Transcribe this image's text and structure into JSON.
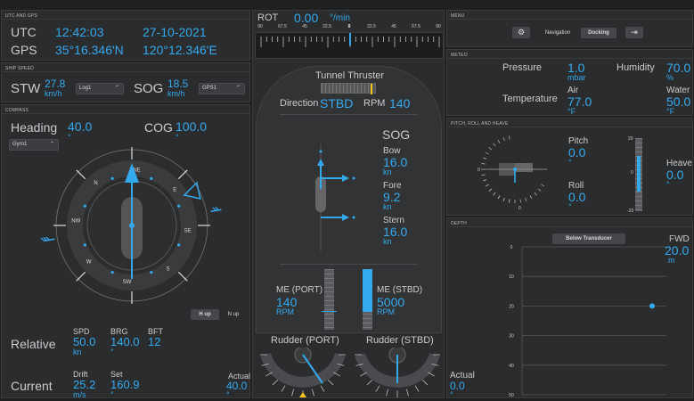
{
  "utc_gps": {
    "header": "UTC AND GPS",
    "utc_label": "UTC",
    "utc_time": "12:42:03",
    "utc_date": "27-10-2021",
    "gps_label": "GPS",
    "gps_lat": "35°16.346'N",
    "gps_lon": "120°12.346'E"
  },
  "ship_speed": {
    "header": "SHIP SPEED",
    "stw_label": "STW",
    "stw_value": "27.8",
    "stw_unit": "km/h",
    "stw_select": "Log1",
    "sog_label": "SOG",
    "sog_value": "18.5",
    "sog_unit": "km/h",
    "sog_select": "GPS1"
  },
  "compass": {
    "header": "COMPASS",
    "heading_label": "Heading",
    "heading_value": "40.0",
    "heading_unit": "°",
    "cog_label": "COG",
    "cog_value": "100.0",
    "cog_unit": "°",
    "gyro_select": "Gyro1",
    "heading_deg": 40,
    "cog_deg": 100,
    "wind_deg": 300,
    "current_deg": 120,
    "directions": [
      "NE",
      "N",
      "E",
      "NW",
      "SE",
      "W",
      "S",
      "SW"
    ],
    "hup_label": "H up",
    "nup_label": "N up",
    "relative_label": "Relative",
    "spd_label": "SPD",
    "spd_value": "50.0",
    "spd_unit": "kn",
    "brg_label": "BRG",
    "brg_value": "140.0",
    "brg_unit": "°",
    "bft_label": "BFT",
    "bft_value": "12",
    "current_label": "Current",
    "drift_label": "Drift",
    "drift_value": "25.2",
    "drift_unit": "m/s",
    "set_label": "Set",
    "set_value": "160.9",
    "set_unit": "°",
    "actual_label": "Actual",
    "actual_value": "40.0",
    "actual_unit": "°"
  },
  "rot": {
    "label": "ROT",
    "value": "0.00",
    "unit": "°/min",
    "ticks": [
      "90",
      "67.5",
      "45",
      "22.5",
      "0",
      "22.5",
      "45",
      "67.5",
      "90"
    ]
  },
  "thruster": {
    "title": "Tunnel Thruster",
    "direction_label": "Direction",
    "direction_value": "STBD",
    "rpm_label": "RPM",
    "rpm_value": "140"
  },
  "sog_panel": {
    "title": "SOG",
    "bow_label": "Bow",
    "bow_value": "16.0",
    "bow_unit": "kn",
    "fore_label": "Fore",
    "fore_value": "9.2",
    "fore_unit": "kn",
    "stern_label": "Stern",
    "stern_value": "16.0",
    "stern_unit": "kn"
  },
  "engines": {
    "port_label": "ME (PORT)",
    "port_value": "140",
    "port_unit": "RPM",
    "port_level": 0.0,
    "stbd_label": "ME (STBD)",
    "stbd_value": "5000",
    "stbd_unit": "RPM",
    "stbd_level": 1.0
  },
  "rudder": {
    "port_label": "Rudder (PORT)",
    "stbd_label": "Rudder (STBD)"
  },
  "menu": {
    "header": "MENU",
    "gear_icon": "gear-icon",
    "navigation_label": "Navigation",
    "docking_label": "Docking",
    "exit_icon": "exit-icon"
  },
  "meteo": {
    "header": "METEO",
    "pressure_label": "Pressure",
    "pressure_value": "1.0",
    "pressure_unit": "mbar",
    "humidity_label": "Humidity",
    "humidity_value": "70.0",
    "humidity_unit": "%",
    "temperature_label": "Temperature",
    "air_label": "Air",
    "air_value": "77.0",
    "air_unit": "°F",
    "water_label": "Water",
    "water_value": "50.0",
    "water_unit": "°F"
  },
  "prh": {
    "header": "PITCH, ROLL AND HEAVE",
    "pitch_label": "Pitch",
    "pitch_value": "0.0",
    "pitch_unit": "°",
    "roll_label": "Roll",
    "roll_value": "0.0",
    "roll_unit": "°",
    "heave_label": "Heave",
    "heave_value": "0.0",
    "heave_unit": "°",
    "pitch_scale_top": "20",
    "pitch_scale_mid": "0",
    "pitch_scale_bottom": "-20"
  },
  "depth": {
    "header": "DEPTH",
    "reference_button": "Below Transducer",
    "fwd_label": "FWD",
    "fwd_value": "20.0",
    "fwd_unit": "m",
    "actual_label": "Actual",
    "actual_value": "0.0",
    "actual_unit": "°",
    "y_ticks": [
      "0",
      "10",
      "20",
      "30",
      "40",
      "50"
    ]
  }
}
